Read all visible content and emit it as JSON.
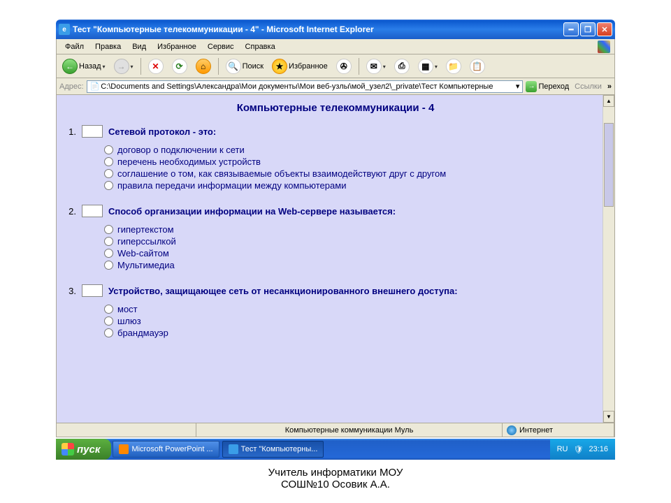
{
  "window": {
    "title": "Тест \"Компьютерные телекоммуникации - 4\" - Microsoft Internet Explorer"
  },
  "menu": [
    "Файл",
    "Правка",
    "Вид",
    "Избранное",
    "Сервис",
    "Справка"
  ],
  "toolbar": {
    "back": "Назад",
    "search": "Поиск",
    "favorites": "Избранное"
  },
  "address": {
    "label": "Адрес:",
    "value": "C:\\Documents and Settings\\Александра\\Мои документы\\Мои веб-узлы\\мой_узел2\\_private\\Тест Компьютерные",
    "go": "Переход",
    "links": "Ссылки"
  },
  "page": {
    "title": "Компьютерные телекоммуникации - 4",
    "questions": [
      {
        "num": "1.",
        "text": "Сетевой протокол - это:",
        "options": [
          "договор о подключении к сети",
          "перечень необходимых устройств",
          "соглашение о том, как связываемые объекты взаимодействуют друг с другом",
          "правила передачи информации между компьютерами"
        ]
      },
      {
        "num": "2.",
        "text": "Способ организации информации на  Web-сервере называется:",
        "options": [
          "гипертекстом",
          "гиперссылкой",
          "Web-сайтом",
          "Мультимедиа"
        ]
      },
      {
        "num": "3.",
        "text": "Устройство, защищающее сеть от несанкционированного внешнего доступа:",
        "options": [
          "мост",
          "шлюз",
          "брандмауэр"
        ]
      }
    ]
  },
  "status": {
    "center": "Компьютерные коммуникации Муль",
    "zone": "Интернет"
  },
  "taskbar": {
    "start": "пуск",
    "items": [
      {
        "label": "Microsoft PowerPoint ...",
        "active": false
      },
      {
        "label": "Тест \"Компьютерны...",
        "active": true
      }
    ],
    "lang": "RU",
    "time": "23:16"
  },
  "caption": {
    "line1": "Учитель информатики МОУ",
    "line2": "СОШ№10 Осовик А.А."
  }
}
